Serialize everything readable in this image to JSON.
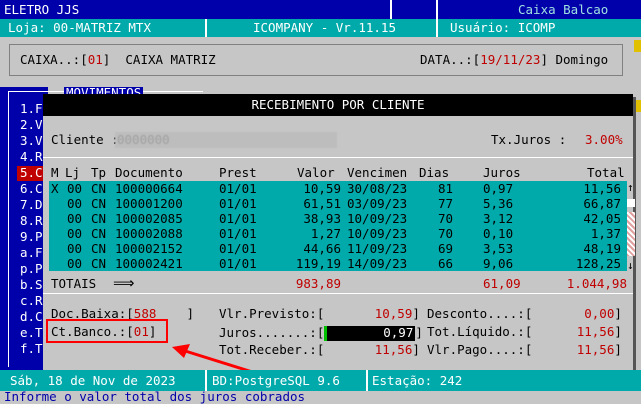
{
  "topbar": {
    "company": "ELETRO JJS",
    "caixa_label": "Caixa Balcao",
    "loja": "Loja: 00-MATRIZ MTX",
    "app": "ICOMPANY - Vr.11.15",
    "usuario": "Usuário: ICOMP"
  },
  "caixa": {
    "label": "CAIXA..:[",
    "code": "01",
    "close": "]",
    "name": "CAIXA MATRIZ",
    "data_label": "DATA..:[",
    "date": "19/11/23",
    "data_close": "]",
    "weekday": "Domingo"
  },
  "menu": {
    "title": "MOVIMENTOS",
    "items": [
      "1.F",
      "2.V",
      "3.V",
      "4.R",
      "5.C",
      "6.C",
      "7.D",
      "8.R",
      "9.P",
      "a.F",
      "p.P",
      "b.S",
      "c.R",
      "d.C",
      "e.T",
      "f.T"
    ]
  },
  "dialog": {
    "title": "RECEBIMENTO POR CLIENTE",
    "cliente_label": "Cliente :",
    "cliente_value": "0000000",
    "taxa_label": "Tx.Juros :",
    "taxa_value": "3.00%",
    "columns": [
      "M",
      "Lj",
      "Tp",
      "Documento",
      "Prest",
      "Valor",
      "Vencimen",
      "Dias",
      "Juros",
      "Total"
    ],
    "rows": [
      {
        "m": "X",
        "lj": "00",
        "tp": "CN",
        "doc": "100000664",
        "prest": "01/01",
        "valor": "10,59",
        "venc": "30/08/23",
        "dias": "81",
        "juros": "0,97",
        "total": "11,56"
      },
      {
        "m": "",
        "lj": "00",
        "tp": "CN",
        "doc": "100001200",
        "prest": "01/01",
        "valor": "61,51",
        "venc": "03/09/23",
        "dias": "77",
        "juros": "5,36",
        "total": "66,87"
      },
      {
        "m": "",
        "lj": "00",
        "tp": "CN",
        "doc": "100002085",
        "prest": "01/01",
        "valor": "38,93",
        "venc": "10/09/23",
        "dias": "70",
        "juros": "3,12",
        "total": "42,05"
      },
      {
        "m": "",
        "lj": "00",
        "tp": "CN",
        "doc": "100002088",
        "prest": "01/01",
        "valor": "1,27",
        "venc": "10/09/23",
        "dias": "70",
        "juros": "0,10",
        "total": "1,37"
      },
      {
        "m": "",
        "lj": "00",
        "tp": "CN",
        "doc": "100002152",
        "prest": "01/01",
        "valor": "44,66",
        "venc": "11/09/23",
        "dias": "69",
        "juros": "3,53",
        "total": "48,19"
      },
      {
        "m": "",
        "lj": "00",
        "tp": "CN",
        "doc": "100002421",
        "prest": "01/01",
        "valor": "119,19",
        "venc": "14/09/23",
        "dias": "66",
        "juros": "9,06",
        "total": "128,25"
      }
    ],
    "totais_label": "TOTAIS",
    "totais_arrow": "⟹",
    "totais_valor": "983,89",
    "totais_juros": "61,09",
    "totais_total": "1.044,98",
    "doc_baixa_label": "Doc.Baixa:[",
    "doc_baixa_value": "588",
    "doc_baixa_close": "]",
    "ct_banco_label": "Ct.Banco.:[",
    "ct_banco_value": "01",
    "ct_banco_close": "]",
    "vlr_previsto_label": "Vlr.Previsto:[",
    "vlr_previsto_value": "10,59",
    "juros_label": "Juros.......:[",
    "juros_value": "0,97",
    "tot_receber_label": "Tot.Receber.:[",
    "tot_receber_value": "11,56",
    "desconto_label": "Desconto....:[",
    "desconto_value": "0,00",
    "tot_liquido_label": "Tot.Líquido.:[",
    "tot_liquido_value": "11,56",
    "vlr_pago_label": "Vlr.Pago....:[",
    "vlr_pago_value": "11,56",
    "bracket_close": "]"
  },
  "statusbar": {
    "date": "Sáb, 18 de Nov de 2023",
    "bd": "BD:PostgreSQL 9.6",
    "estacao": "Estação: 242"
  },
  "message": "Informe o valor total dos juros cobrados",
  "colors": {
    "blue": "#0000aa",
    "cyan": "#00aaaa",
    "red": "#c00000",
    "highlight": "#ff0000"
  }
}
